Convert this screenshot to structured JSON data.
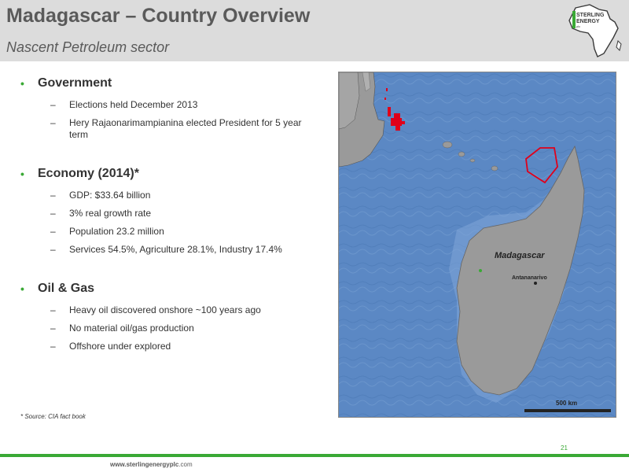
{
  "header": {
    "title": "Madagascar – Country Overview",
    "subtitle": "Nascent  Petroleum sector",
    "logo_text": "STERLING ENERGY plc"
  },
  "sections": [
    {
      "heading": "Government",
      "items": [
        "Elections held December 2013",
        "Hery Rajaonarimampianina elected President for 5 year term"
      ]
    },
    {
      "heading": "Economy (2014)*",
      "items": [
        "GDP: $33.64 billion",
        "3% real growth rate",
        "Population 23.2 million",
        "Services 54.5%, Agriculture 28.1%, Industry 17.4%"
      ]
    },
    {
      "heading": "Oil & Gas",
      "items": [
        "Heavy oil discovered onshore ~100 years ago",
        "No material oil/gas production",
        "Offshore under explored"
      ]
    }
  ],
  "bullet_char": "•",
  "dash_char": "–",
  "source_note": "* Source: CIA fact book",
  "map": {
    "country_label": "Madagascar",
    "capital_label": "Antananarivo",
    "scale_label": "500 km"
  },
  "footer": {
    "page_number": "21",
    "url_bold": "www.sterlingenergyplc",
    "url_rest": ".com"
  },
  "colors": {
    "accent_green": "#3aa935",
    "header_bg": "#dcdcdc",
    "ocean": "#5b88c4",
    "land": "#9a9a9a",
    "licence_red": "#e0001a"
  }
}
